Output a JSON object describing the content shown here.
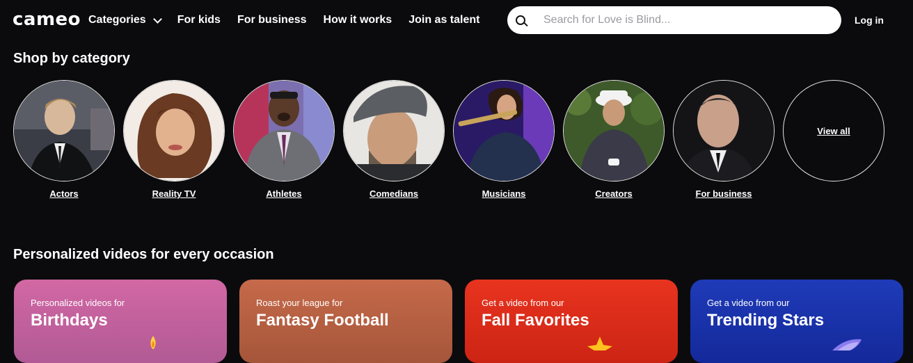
{
  "header": {
    "logo": "cameo",
    "nav": [
      {
        "label": "Categories"
      },
      {
        "label": "For kids"
      },
      {
        "label": "For business"
      },
      {
        "label": "How it works"
      },
      {
        "label": "Join as talent"
      }
    ],
    "search": {
      "placeholder": "Search for Love is Blind..."
    },
    "login": "Log in"
  },
  "categories": {
    "title": "Shop by category",
    "items": [
      {
        "label": "Actors"
      },
      {
        "label": "Reality TV"
      },
      {
        "label": "Athletes"
      },
      {
        "label": "Comedians"
      },
      {
        "label": "Musicians"
      },
      {
        "label": "Creators"
      },
      {
        "label": "For business"
      }
    ],
    "view_all": "View all"
  },
  "occasions": {
    "title": "Personalized videos for every occasion",
    "cards": [
      {
        "pre": "Personalized videos for",
        "title": "Birthdays",
        "color": "#c1609a"
      },
      {
        "pre": "Roast your league for",
        "title": "Fantasy Football",
        "color": "#b9603f"
      },
      {
        "pre": "Get a video from our",
        "title": "Fall Favorites",
        "color": "#d82a1c"
      },
      {
        "pre": "Get a video from our",
        "title": "Trending Stars",
        "color": "#1d36a8"
      }
    ]
  }
}
